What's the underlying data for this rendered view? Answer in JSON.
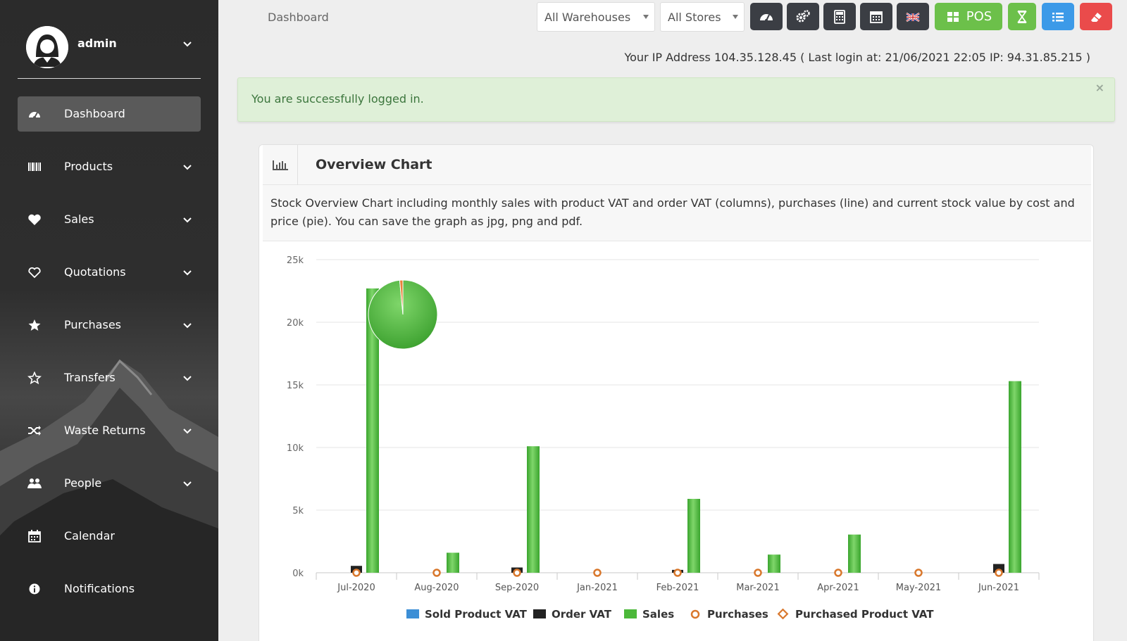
{
  "user": {
    "name": "admin"
  },
  "sidebar": {
    "items": [
      {
        "label": "Dashboard",
        "icon": "dashboard-icon",
        "active": true,
        "caret": false
      },
      {
        "label": "Products",
        "icon": "barcode-icon",
        "caret": true
      },
      {
        "label": "Sales",
        "icon": "heart-icon",
        "caret": true
      },
      {
        "label": "Quotations",
        "icon": "heart-outline-icon",
        "caret": true
      },
      {
        "label": "Purchases",
        "icon": "star-icon",
        "caret": true
      },
      {
        "label": "Transfers",
        "icon": "star-outline-icon",
        "caret": true
      },
      {
        "label": "Waste Returns",
        "icon": "random-icon",
        "caret": true
      },
      {
        "label": "People",
        "icon": "users-icon",
        "caret": true
      },
      {
        "label": "Calendar",
        "icon": "calendar-icon",
        "caret": false
      },
      {
        "label": "Notifications",
        "icon": "info-icon",
        "caret": false
      }
    ]
  },
  "header": {
    "breadcrumb": "Dashboard",
    "warehouse_select": "All Warehouses",
    "store_select": "All Stores",
    "pos_label": "POS",
    "ip_line": "Your IP Address 104.35.128.45 ( Last login at: 21/06/2021 22:05 IP: 94.31.85.215 )"
  },
  "colors": {
    "green": "#6cc04a",
    "blue": "#3c9ae8",
    "red": "#ea4b4b",
    "dark": "#3b3e44"
  },
  "alert": {
    "message": "You are successfully logged in.",
    "close": "×"
  },
  "panel": {
    "title": "Overview Chart",
    "description": "Stock Overview Chart including monthly sales with product VAT and order VAT (columns), purchases (line) and current stock value by cost and price (pie). You can save the graph as jpg, png and pdf."
  },
  "chart_data": {
    "type": "bar",
    "categories": [
      "Jul-2020",
      "Aug-2020",
      "Sep-2020",
      "Jan-2021",
      "Feb-2021",
      "Mar-2021",
      "Apr-2021",
      "May-2021",
      "Jun-2021"
    ],
    "yticks": [
      "0k",
      "5k",
      "10k",
      "15k",
      "20k",
      "25k"
    ],
    "ylim": [
      0,
      25000
    ],
    "series": [
      {
        "name": "Sold Product VAT",
        "kind": "column",
        "color": "#3c8fd6",
        "values": [
          0,
          0,
          0,
          0,
          0,
          0,
          0,
          0,
          0
        ]
      },
      {
        "name": "Order VAT",
        "kind": "column",
        "color": "#222222",
        "values": [
          550,
          0,
          420,
          0,
          230,
          0,
          0,
          0,
          700
        ]
      },
      {
        "name": "Sales",
        "kind": "column",
        "color": "#4cb83a",
        "values": [
          22700,
          1600,
          10100,
          0,
          5900,
          1450,
          3050,
          0,
          15300
        ]
      },
      {
        "name": "Purchases",
        "kind": "line-marker",
        "color": "#d9782d",
        "values": [
          0,
          0,
          0,
          0,
          0,
          0,
          0,
          0,
          0
        ]
      },
      {
        "name": "Purchased Product VAT",
        "kind": "line-marker",
        "color": "#d9782d",
        "values": [
          0,
          0,
          0,
          0,
          0,
          0,
          0,
          0,
          0
        ]
      }
    ],
    "pie": {
      "slices": [
        {
          "value": 98.5,
          "color": "#4cb83a"
        },
        {
          "value": 1.5,
          "color": "#e8823a"
        }
      ]
    },
    "legend_position": "bottom"
  }
}
